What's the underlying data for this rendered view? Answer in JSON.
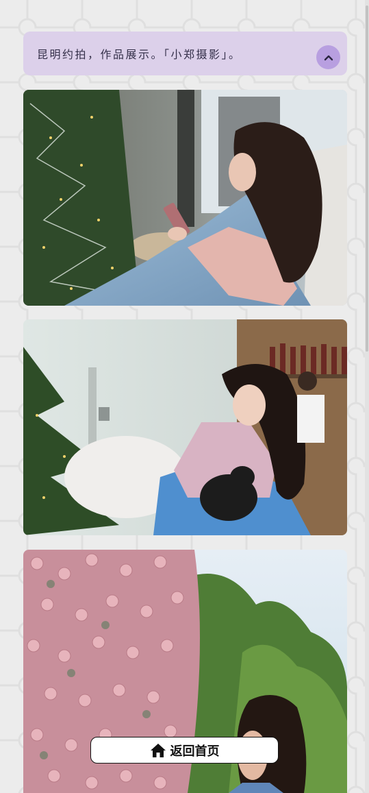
{
  "header": {
    "title": "昆明约拍，作品展示。「小郑摄影」。"
  },
  "icons": {
    "collapse": "chevron-up-icon",
    "home": "home-icon"
  },
  "gallery": {
    "photos": [
      {
        "subject": "woman in pink sweater under blue blanket looking at phone beside a christmas tree"
      },
      {
        "subject": "woman in pink sweater with blue blanket holding a black cat in a bar"
      },
      {
        "subject": "woman in front of a wall of pink roses in a garden"
      }
    ]
  },
  "footer": {
    "home_label": "返回首页"
  },
  "colors": {
    "page_bg": "#ececec",
    "header_bg": "#dcd0ea",
    "accent_button": "#b89fe0"
  }
}
